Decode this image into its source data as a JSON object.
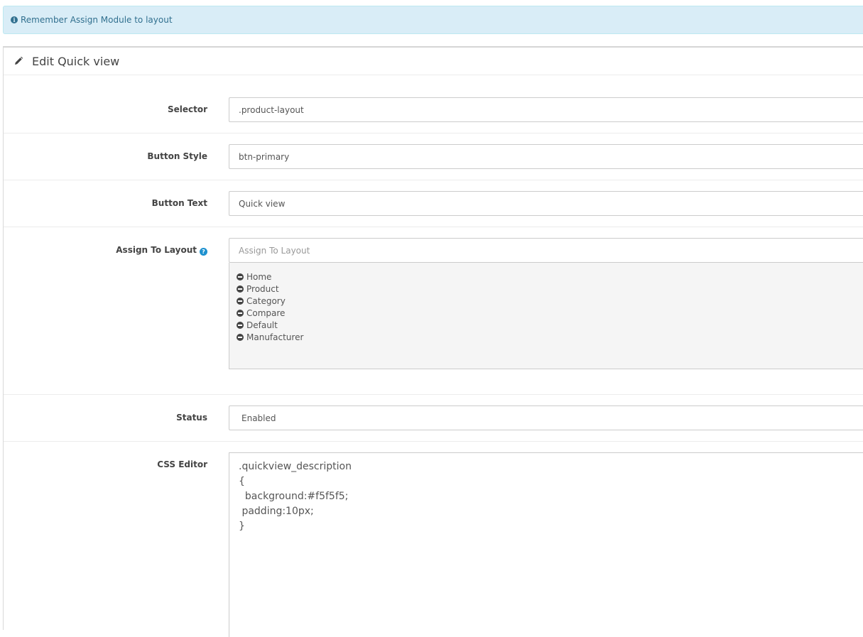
{
  "alert": {
    "text": "Remember Assign Module to layout",
    "icon": "info-circle-icon"
  },
  "panel": {
    "title": "Edit Quick view",
    "icon": "pencil-icon"
  },
  "form": {
    "selector": {
      "label": "Selector",
      "value": ".product-layout"
    },
    "button_style": {
      "label": "Button Style",
      "value": "btn-primary"
    },
    "button_text": {
      "label": "Button Text",
      "value": "Quick view"
    },
    "assign_layout": {
      "label": "Assign To Layout",
      "placeholder": "Assign To Layout",
      "items": [
        "Home",
        "Product",
        "Category",
        "Compare",
        "Default",
        "Manufacturer"
      ]
    },
    "status": {
      "label": "Status",
      "value": "Enabled"
    },
    "css_editor": {
      "label": "CSS Editor",
      "value": ".quickview_description\n{\n  background:#f5f5f5;\n padding:10px;\n}"
    }
  },
  "colors": {
    "alert_bg": "#d9edf7",
    "alert_text": "#31708f",
    "help_icon": "#1e91cf"
  }
}
